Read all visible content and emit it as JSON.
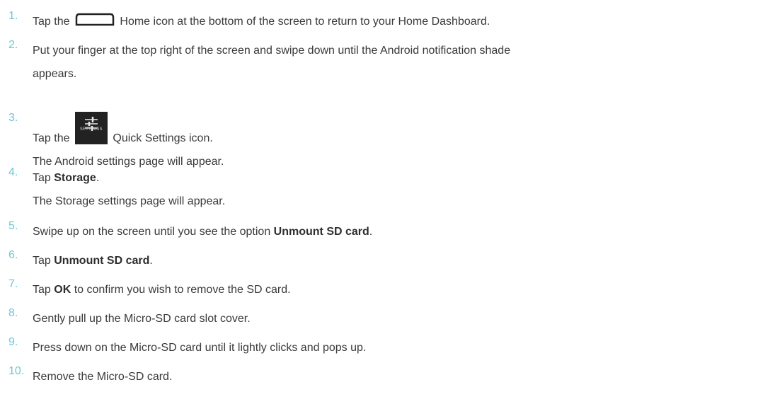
{
  "steps": [
    {
      "num": "1.",
      "before": "Tap the ",
      "icon": "home-icon",
      "after": " Home icon at the bottom of the screen to return to your Home Dashboard."
    },
    {
      "num": "2.",
      "line1": "Put your finger at the top right of the screen and swipe down until the Android notification shade",
      "line2": "appears."
    },
    {
      "num": "3.",
      "before": "Tap the ",
      "icon": "settings-icon",
      "icon_caption": "SETTINGS",
      "after": " Quick Settings icon.",
      "sub": "The Android settings page will appear."
    },
    {
      "num": "4.",
      "before": "Tap ",
      "bold": "Storage",
      "after": ".",
      "sub": "The Storage settings page will appear."
    },
    {
      "num": "5.",
      "before": "Swipe up on the screen until you see the option ",
      "bold": "Unmount SD card",
      "after": "."
    },
    {
      "num": "6.",
      "before": "Tap ",
      "bold": "Unmount SD card",
      "after": "."
    },
    {
      "num": "7.",
      "before": "Tap ",
      "bold": "OK",
      "after": " to confirm you wish to remove the SD card."
    },
    {
      "num": "8.",
      "text": "Gently pull up the Micro-SD card slot cover."
    },
    {
      "num": "9.",
      "text": "Press down on the Micro-SD card until it lightly clicks and pops up."
    },
    {
      "num": "10.",
      "text": "Remove the Micro-SD card."
    }
  ],
  "colors": {
    "number": "#6ec6d8",
    "text": "#3a3a3a"
  }
}
